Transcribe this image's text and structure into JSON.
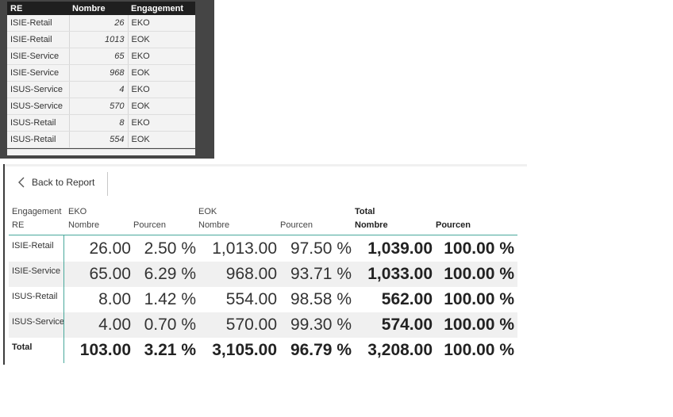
{
  "source_table": {
    "headers": [
      "RE",
      "Nombre",
      "Engagement"
    ],
    "rows": [
      [
        "ISIE-Retail",
        "26",
        "EKO"
      ],
      [
        "ISIE-Retail",
        "1013",
        "EOK"
      ],
      [
        "ISIE-Service",
        "65",
        "EKO"
      ],
      [
        "ISIE-Service",
        "968",
        "EOK"
      ],
      [
        "ISUS-Service",
        "4",
        "EKO"
      ],
      [
        "ISUS-Service",
        "570",
        "EOK"
      ],
      [
        "ISUS-Retail",
        "8",
        "EKO"
      ],
      [
        "ISUS-Retail",
        "554",
        "EOK"
      ]
    ]
  },
  "report": {
    "back_label": "Back to Report",
    "header": {
      "engagement_label": "Engagement",
      "re_label": "RE",
      "groups": [
        "EKO",
        "EOK",
        "Total"
      ],
      "columns": [
        "Nombre",
        "Pourcen",
        "Nombre",
        "Pourcen",
        "Nombre",
        "Pourcen"
      ]
    },
    "rows": [
      {
        "label": "ISIE-Retail",
        "values": [
          "26.00",
          "2.50 %",
          "1,013.00",
          "97.50 %",
          "1,039.00",
          "100.00 %"
        ]
      },
      {
        "label": "ISIE-Service",
        "values": [
          "65.00",
          "6.29 %",
          "968.00",
          "93.71 %",
          "1,033.00",
          "100.00 %"
        ]
      },
      {
        "label": "ISUS-Retail",
        "values": [
          "8.00",
          "1.42 %",
          "554.00",
          "98.58 %",
          "562.00",
          "100.00 %"
        ]
      },
      {
        "label": "ISUS-Service",
        "values": [
          "4.00",
          "0.70 %",
          "570.00",
          "99.30 %",
          "574.00",
          "100.00 %"
        ]
      }
    ],
    "total": {
      "label": "Total",
      "values": [
        "103.00",
        "3.21 %",
        "3,105.00",
        "96.79 %",
        "3,208.00",
        "100.00 %"
      ]
    }
  }
}
